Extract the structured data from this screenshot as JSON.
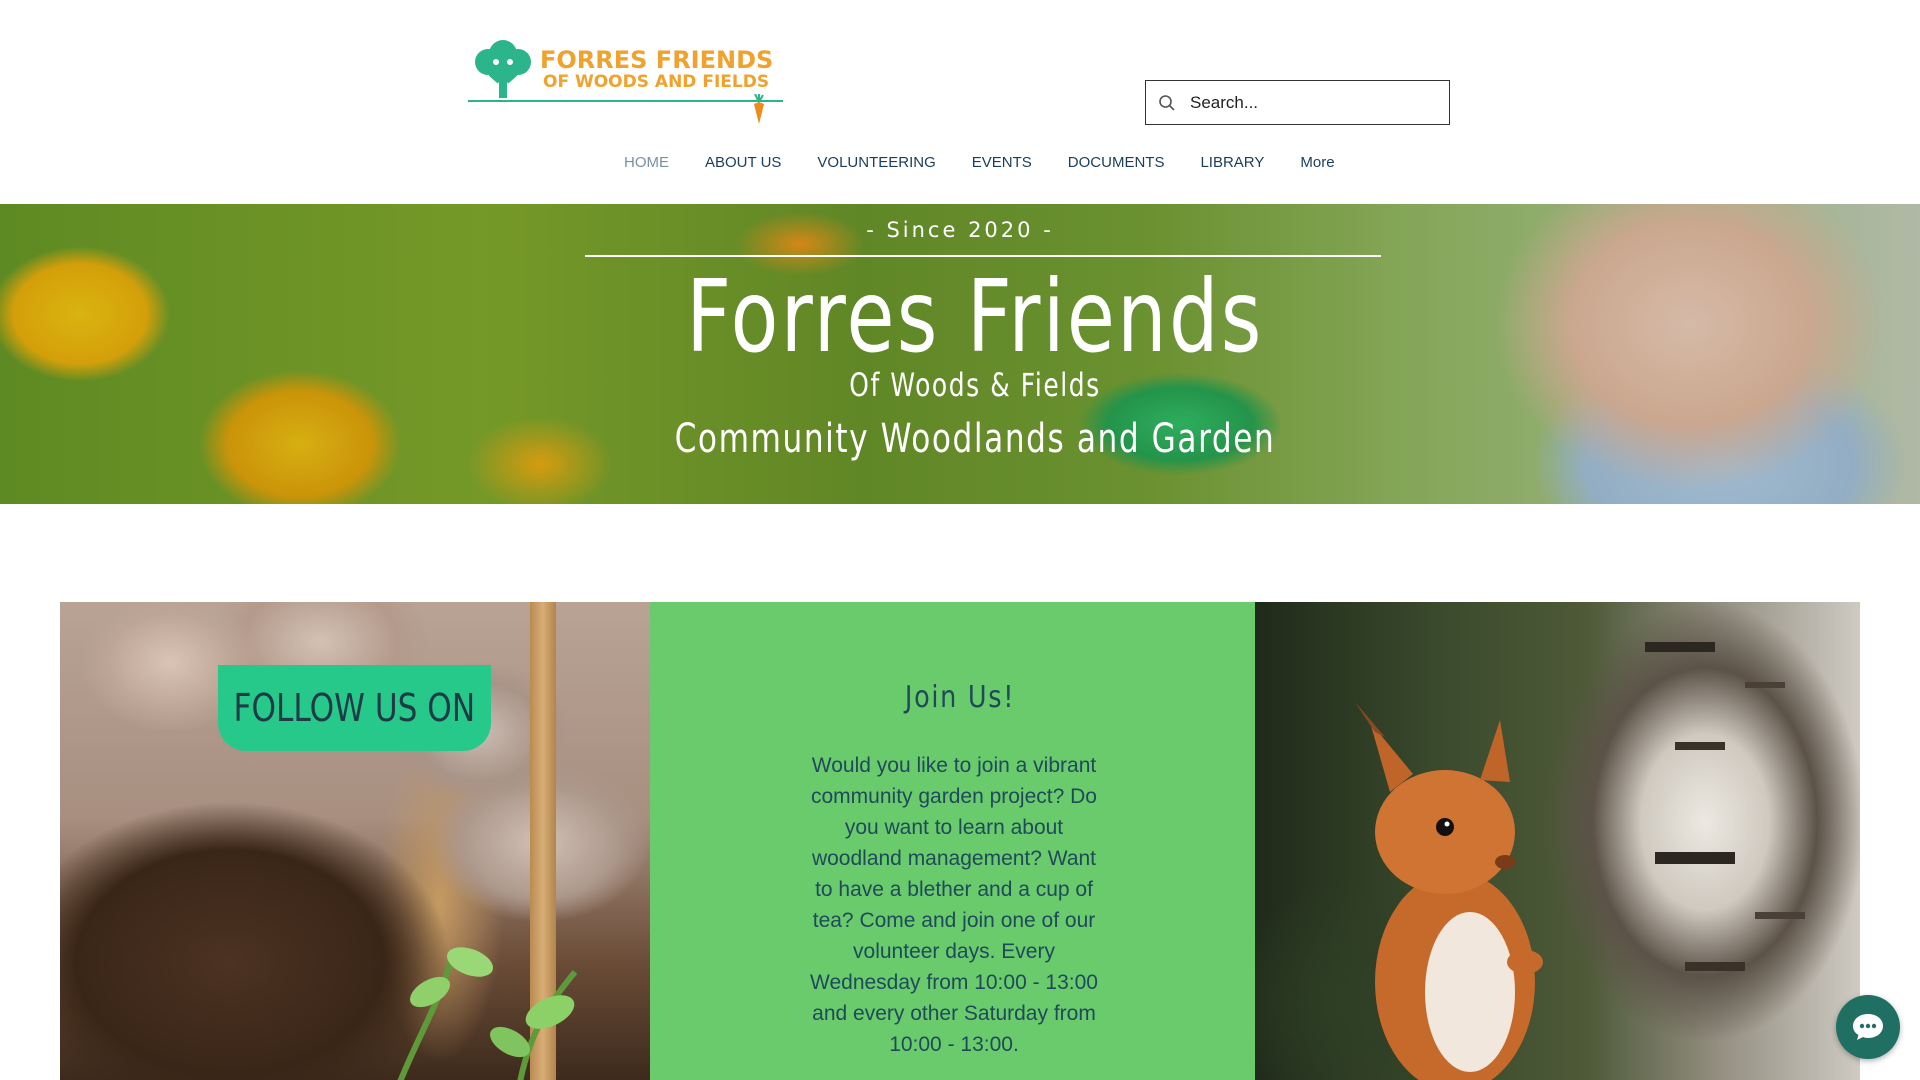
{
  "logo": {
    "line1": "FORRES FRIENDS",
    "line2": "OF WOODS AND FIELDS",
    "tree_color": "#2cb58a",
    "text_color": "#f0a22e",
    "carrot_color": "#f08a1a"
  },
  "search": {
    "placeholder": "Search..."
  },
  "nav": {
    "items": [
      {
        "label": "HOME",
        "active": true
      },
      {
        "label": "ABOUT US"
      },
      {
        "label": "VOLUNTEERING"
      },
      {
        "label": "EVENTS"
      },
      {
        "label": "DOCUMENTS"
      },
      {
        "label": "LIBRARY"
      },
      {
        "label": "More"
      }
    ],
    "text_color": "#1b3d5a",
    "active_color": "#7a8fa3"
  },
  "hero": {
    "since": "- Since 2020 -",
    "title": "Forres Friends",
    "subtitle": "Of Woods & Fields",
    "tagline": "Community Woodlands and Garden"
  },
  "follow": {
    "label": "FOLLOW US ON",
    "color": "#27c98b"
  },
  "join": {
    "title": "Join Us!",
    "body": "Would you like to join a vibrant community garden project? Do you want to learn about woodland management? Want to have a blether and a cup of tea? Come and join one of our volunteer days. Every Wednesday from 10:00 - 13:00 and every other Saturday from 10:00 - 13:00.",
    "bg_color": "#6acb6c"
  },
  "chat": {
    "icon": "chat-bubble-icon",
    "color": "#1f6f63"
  }
}
